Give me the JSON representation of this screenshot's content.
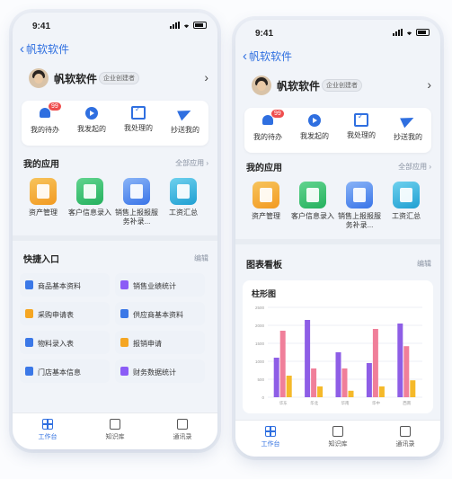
{
  "status": {
    "time": "9:41"
  },
  "nav": {
    "back_label": "帆软软件"
  },
  "profile": {
    "name": "帆软软件",
    "role_badge": "企业创建者"
  },
  "tasks": [
    {
      "label": "我的待办",
      "icon": "bell-icon",
      "badge": "99"
    },
    {
      "label": "我发起的",
      "icon": "play-icon"
    },
    {
      "label": "我处理的",
      "icon": "inbox-check-icon"
    },
    {
      "label": "抄送我的",
      "icon": "paper-plane-icon"
    }
  ],
  "my_apps": {
    "title": "我的应用",
    "link": "全部应用",
    "items": [
      {
        "label": "资产管理",
        "color": "#f29a21"
      },
      {
        "label": "客户信息录入",
        "color": "#25b15e"
      },
      {
        "label": "销售上报报服务补录...",
        "color": "#3974e8"
      },
      {
        "label": "工资汇总",
        "color": "#1f9fd2"
      }
    ]
  },
  "quick": {
    "title": "快捷入口",
    "edit": "编辑",
    "items": [
      {
        "label": "商品基本资料",
        "color": "#3b78e7"
      },
      {
        "label": "销售业绩统计",
        "color": "#8b5cf6"
      },
      {
        "label": "采购申请表",
        "color": "#f5a623"
      },
      {
        "label": "供应商基本资料",
        "color": "#3b78e7"
      },
      {
        "label": "物料录入表",
        "color": "#3b78e7"
      },
      {
        "label": "报销申请",
        "color": "#f5a623"
      },
      {
        "label": "门店基本信息",
        "color": "#3b78e7"
      },
      {
        "label": "财务数据统计",
        "color": "#8b5cf6"
      }
    ]
  },
  "board": {
    "title": "图表看板",
    "edit": "编辑",
    "chart_title": "柱形图"
  },
  "tabs": [
    {
      "label": "工作台",
      "active": true
    },
    {
      "label": "知识库",
      "active": false
    },
    {
      "label": "通讯录",
      "active": false
    }
  ],
  "chart_data": {
    "type": "bar",
    "title": "柱形图",
    "categories": [
      "华东",
      "华北",
      "华南",
      "华中",
      "西南"
    ],
    "ylim": [
      0,
      2500
    ],
    "yticks": [
      "0",
      "500",
      "1000",
      "1500",
      "2000",
      "2500"
    ],
    "series": [
      {
        "values": [
          1100,
          2150,
          1250,
          950,
          2050
        ],
        "color": "#8e5ee6"
      },
      {
        "values": [
          1850,
          800,
          800,
          1900,
          1420
        ],
        "color": "#f07f9a"
      },
      {
        "values": [
          600,
          300,
          180,
          300,
          470
        ],
        "color": "#f5b92a"
      }
    ]
  }
}
